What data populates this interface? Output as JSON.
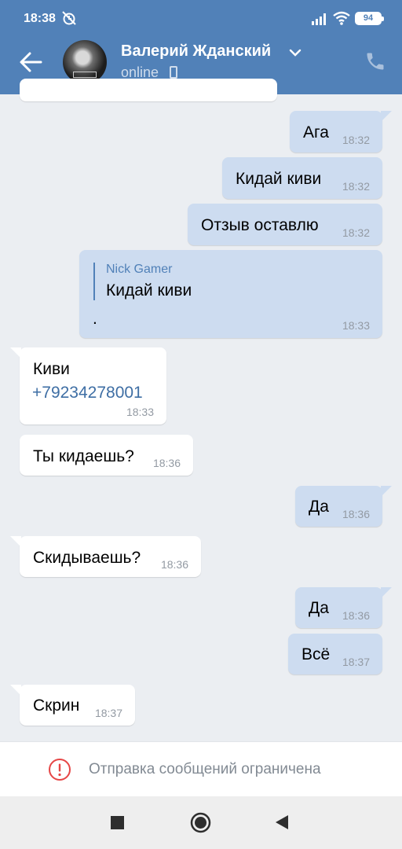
{
  "status_bar": {
    "time": "18:38",
    "battery": "94"
  },
  "header": {
    "title": "Валерий Жданский",
    "status": "online"
  },
  "messages": [
    {
      "text": "Ага",
      "time": "18:32"
    },
    {
      "text": "Кидай киви",
      "time": "18:32"
    },
    {
      "text": "Отзыв оставлю",
      "time": "18:32"
    },
    {
      "reply_author": "Nick Gamer",
      "reply_text": "Кидай киви",
      "text": ".",
      "time": "18:33"
    },
    {
      "text": "Киви",
      "link": "+79234278001",
      "time": "18:33"
    },
    {
      "text": "Ты кидаешь?",
      "time": "18:36"
    },
    {
      "text": "Да",
      "time": "18:36"
    },
    {
      "text": "Скидываешь?",
      "time": "18:36"
    },
    {
      "text": "Да",
      "time": "18:36"
    },
    {
      "text": "Всё",
      "time": "18:37"
    },
    {
      "text": "Скрин",
      "time": "18:37"
    }
  ],
  "restriction": {
    "text": "Отправка сообщений ограничена"
  },
  "colors": {
    "header": "#5181b8",
    "outgoing_bubble": "#cddcf0",
    "incoming_bubble": "#ffffff",
    "background": "#ebeef2",
    "warning": "#e64646"
  },
  "icons": [
    "back-arrow-icon",
    "chevron-down-icon",
    "mobile-icon",
    "phone-icon",
    "warning-icon",
    "recents-icon",
    "home-icon",
    "nav-back-icon"
  ]
}
